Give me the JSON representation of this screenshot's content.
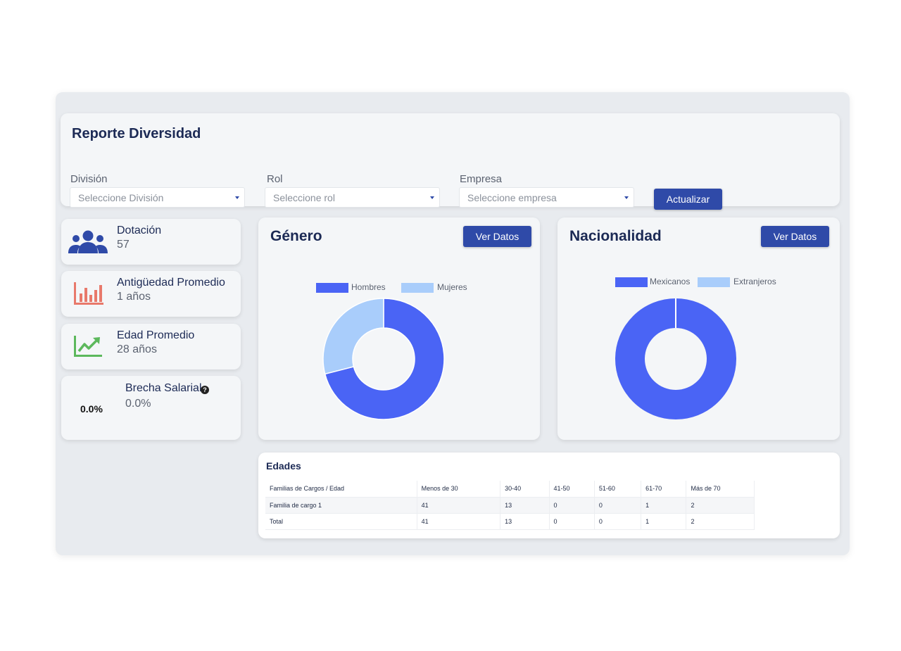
{
  "header": {
    "title": "Reporte Diversidad",
    "filters": [
      {
        "label": "División",
        "placeholder": "Seleccione División"
      },
      {
        "label": "Rol",
        "placeholder": "Seleccione rol"
      },
      {
        "label": "Empresa",
        "placeholder": "Seleccione empresa"
      }
    ],
    "update_button": "Actualizar"
  },
  "stats": [
    {
      "title": "Dotación",
      "value": "57",
      "icon": "people-icon",
      "color": "#2f4aa8"
    },
    {
      "title": "Antigüedad Promedio",
      "value": "1 años",
      "icon": "bar-chart-icon",
      "color": "#e8796b"
    },
    {
      "title": "Edad Promedio",
      "value": "28 años",
      "icon": "trend-up-icon",
      "color": "#5cb85c"
    },
    {
      "title": "Brecha Salarial",
      "value": "0.0%",
      "badge": "0.0%",
      "icon": "help-icon"
    }
  ],
  "charts": {
    "genero": {
      "title": "Género",
      "button": "Ver Datos"
    },
    "nacionalidad": {
      "title": "Nacionalidad",
      "button": "Ver Datos"
    }
  },
  "chart_data": [
    {
      "type": "pie",
      "title": "Género",
      "labels": [
        "Hombres",
        "Mujeres"
      ],
      "values": [
        71,
        29
      ],
      "colors": [
        "#4a64f5",
        "#a9cdfb"
      ],
      "legend": "top"
    },
    {
      "type": "pie",
      "title": "Nacionalidad",
      "labels": [
        "Mexicanos",
        "Extranjeros"
      ],
      "values": [
        100,
        0
      ],
      "colors": [
        "#4a64f5",
        "#a9cdfb"
      ],
      "legend": "top"
    }
  ],
  "ages_table": {
    "title": "Edades",
    "columns": [
      "Familias de Cargos / Edad",
      "Menos de 30",
      "30-40",
      "41-50",
      "51-60",
      "61-70",
      "Más de 70"
    ],
    "rows": [
      [
        "Familia de cargo 1",
        "41",
        "13",
        "0",
        "0",
        "1",
        "2"
      ],
      [
        "Total",
        "41",
        "13",
        "0",
        "0",
        "1",
        "2"
      ]
    ]
  }
}
